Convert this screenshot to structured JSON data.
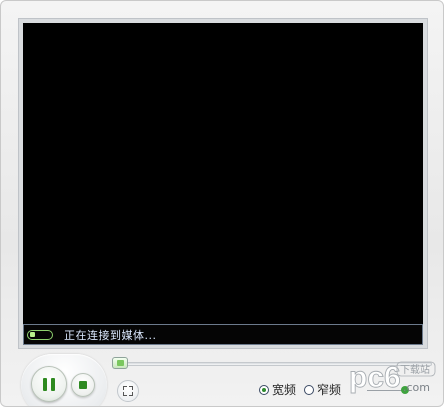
{
  "player": {
    "status": {
      "text": "正在连接到媒体..."
    },
    "seek": {
      "position": 0
    },
    "bandwidth_options": [
      {
        "label": "宽频",
        "selected": true
      },
      {
        "label": "窄频",
        "selected": false
      }
    ],
    "volume": {
      "level": 0.8
    }
  },
  "icons": {
    "play_pause": "pause-icon",
    "stop": "stop-icon",
    "fullscreen": "fullscreen-icon"
  },
  "watermark": {
    "logo_text": "pc6",
    "sub_text": "下载站",
    "suffix": ".com"
  },
  "colors": {
    "accent_green": "#2e8a1f",
    "video_bg": "#000000",
    "status_text": "#dce9ff"
  }
}
